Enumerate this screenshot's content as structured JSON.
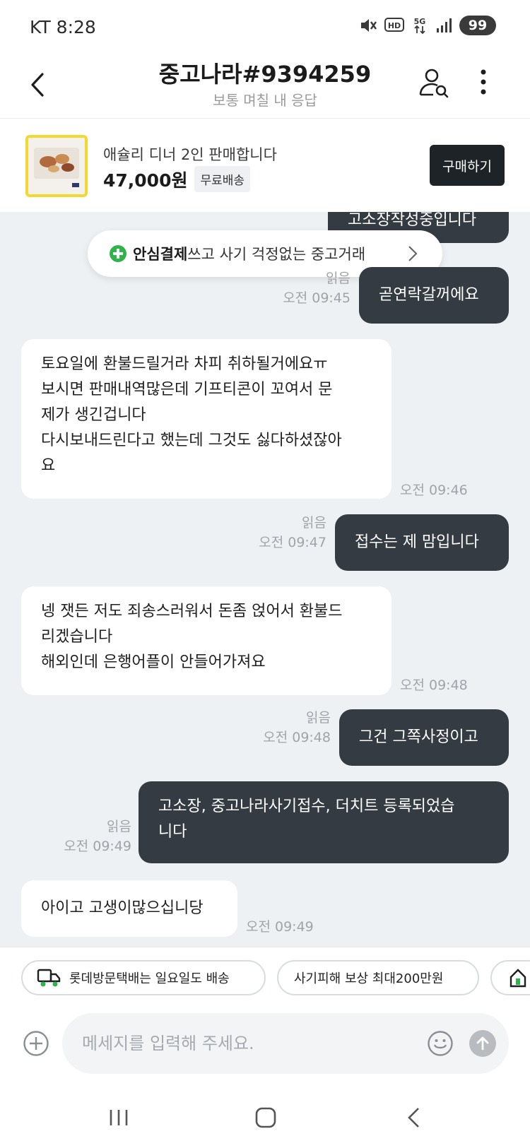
{
  "status_bar": {
    "carrier_time": "KT 8:28",
    "battery": "99"
  },
  "header": {
    "title": "중고나라#9394259",
    "subtitle": "보통 며칠 내 응답"
  },
  "product": {
    "name": "애슐리 디너 2인 판매합니다",
    "price": "47,000원",
    "shipping": "무료배송",
    "buy_label": "구매하기"
  },
  "banner": {
    "bold": "안심결제",
    "rest": "쓰고 사기 걱정없는 중고거래"
  },
  "messages": [
    {
      "dir": "out",
      "text": "고소장작성중입니다",
      "read": "",
      "time": ""
    },
    {
      "dir": "out",
      "text": "곧연락갈꺼에요",
      "read": "읽음",
      "time": "오전 09:45"
    },
    {
      "dir": "in",
      "lines": [
        "토요일에 환불드릴거라 차피 취하될거에요ㅠ",
        "보시면 판매내역많은데 기프티콘이 꼬여서 문",
        "제가 생긴겁니다",
        "다시보내드린다고 했는데 그것도 싫다하셨잖아",
        "요"
      ],
      "time": "오전 09:46"
    },
    {
      "dir": "out",
      "text": "접수는 제 맘입니다",
      "read": "읽음",
      "time": "오전 09:47"
    },
    {
      "dir": "in",
      "lines": [
        "넹 잿든 저도 죄송스러워서 돈좀 얹어서 환불드",
        "리겠습니다",
        "해외인데 은행어플이 안들어가져요"
      ],
      "time": "오전 09:48"
    },
    {
      "dir": "out",
      "text": "그건 그쪽사정이고",
      "read": "읽음",
      "time": "오전 09:48"
    },
    {
      "dir": "out",
      "lines": [
        "고소장, 중고나라사기접수, 더치트 등록되었습",
        "니다"
      ],
      "read": "읽음",
      "time": "오전 09:49"
    },
    {
      "dir": "in",
      "text": "아이고 고생이많으십니당",
      "time": "오전 09:49"
    }
  ],
  "chips": [
    "롯데방문택배는 일요일도 배송",
    "사기피해 보상 최대200만원"
  ],
  "input": {
    "placeholder": "메세지를 입력해 주세요."
  },
  "colors": {
    "outgoing_bubble": "#353b42",
    "chat_bg": "#eef1f4",
    "safe_icon": "#2fb34a",
    "thumb_border": "#f1d92f"
  }
}
